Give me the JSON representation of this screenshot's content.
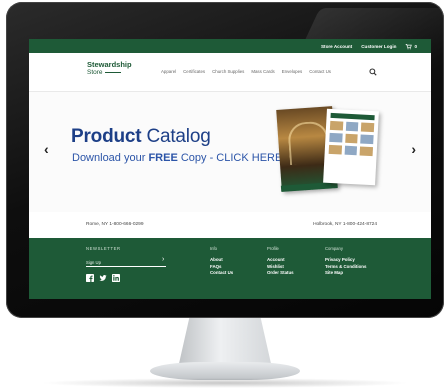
{
  "topbar": {
    "store_account": "Store Account",
    "customer_login": "Customer Login",
    "cart_count": "0"
  },
  "logo": {
    "line1": "Stewardship",
    "line2": "Store"
  },
  "nav": {
    "items": [
      "Apparel",
      "Certificates",
      "Church Supplies",
      "Mass Cards",
      "Envelopes",
      "Contact Us"
    ]
  },
  "hero": {
    "title_bold": "Product",
    "title_rest": " Catalog",
    "sub_pre": "Download your ",
    "sub_bold": "FREE",
    "sub_post": " Copy - CLICK HERE",
    "prev_glyph": "‹",
    "next_glyph": "›"
  },
  "locations": {
    "left": "Rome, NY 1-800-666-0299",
    "right": "Holbrook, NY 1-800-424-8724"
  },
  "footer": {
    "newsletter_label": "NEWSLETTER",
    "signup_placeholder": "Sign Up",
    "info": {
      "head": "Info",
      "links": [
        "About",
        "FAQs",
        "Contact Us"
      ]
    },
    "profile": {
      "head": "Profile",
      "links": [
        "Account",
        "Wishlist",
        "Order Status"
      ]
    },
    "company": {
      "head": "Company",
      "links": [
        "Privacy Policy",
        "Terms & Conditions",
        "Site Map"
      ]
    }
  },
  "colors": {
    "brand_green": "#1e5a37",
    "hero_blue": "#1d3f87"
  },
  "icons": [
    "cart-icon",
    "search-icon",
    "facebook-icon",
    "twitter-icon",
    "linkedin-icon"
  ]
}
